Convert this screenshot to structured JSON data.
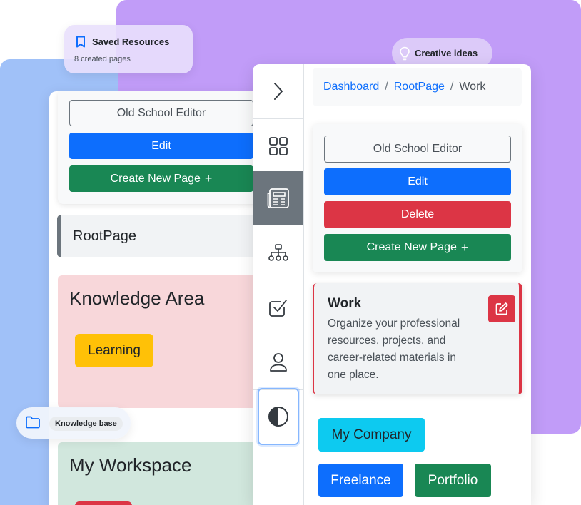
{
  "badges": {
    "saved_resources": {
      "title": "Saved Resources",
      "subtitle": "8 created pages",
      "icon": "bookmark-icon"
    },
    "creative_ideas": {
      "title": "Creative ideas",
      "icon": "lightbulb-icon"
    },
    "knowledge_base": {
      "title": "Knowledge base",
      "icon": "folder-icon"
    }
  },
  "background_panel": {
    "old_school_editor": "Old School Editor",
    "edit": "Edit",
    "create_new_page": "Create New Page",
    "root_page": "RootPage",
    "knowledge_area": {
      "title": "Knowledge Area",
      "tag": "Learning"
    },
    "workspace": {
      "title": "My Workspace"
    }
  },
  "sidebar": {
    "items": [
      {
        "icon": "chevron-right-icon"
      },
      {
        "icon": "grid-icon"
      },
      {
        "icon": "newspaper-icon",
        "active": true
      },
      {
        "icon": "sitemap-icon"
      },
      {
        "icon": "checkbox-icon"
      },
      {
        "icon": "person-icon"
      },
      {
        "icon": "contrast-icon"
      }
    ]
  },
  "breadcrumb": {
    "items": [
      "Dashboard",
      "RootPage"
    ],
    "separator": "/",
    "current": "Work"
  },
  "actions": {
    "old_school_editor": "Old School Editor",
    "edit": "Edit",
    "delete": "Delete",
    "create_new_page": "Create New Page",
    "plus": "+"
  },
  "work": {
    "title": "Work",
    "description": "Organize your professional resources, projects, and career-related materials in one place."
  },
  "tags": [
    "My Company",
    "Freelance",
    "Portfolio"
  ],
  "colors": {
    "primary": "#0d6efd",
    "danger": "#dc3545",
    "success": "#198754",
    "warning": "#ffc107",
    "info": "#0dcaf0",
    "secondary": "#6c757d",
    "purple_bg": "#c19cf8",
    "blue_bg": "#a0c1f8"
  }
}
